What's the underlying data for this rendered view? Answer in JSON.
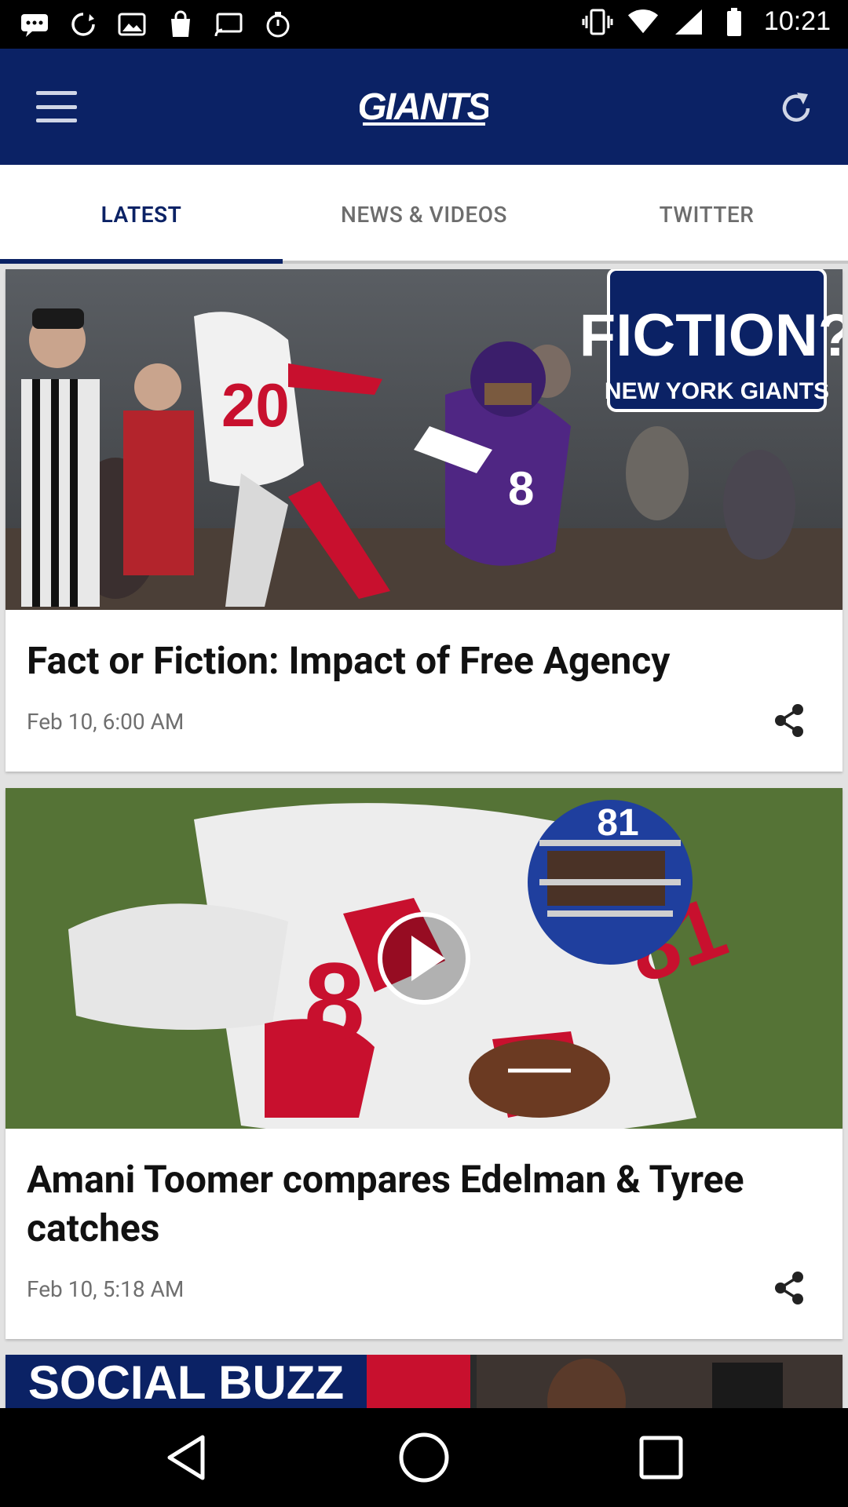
{
  "status_bar": {
    "time": "10:21"
  },
  "app_bar": {
    "logo_text": "GIANTS"
  },
  "tabs": [
    {
      "label": "LATEST"
    },
    {
      "label": "NEWS & VIDEOS"
    },
    {
      "label": "TWITTER"
    }
  ],
  "feed": [
    {
      "title": "Fact or Fiction: Impact of Free Agency",
      "date": "Feb 10, 6:00 AM",
      "image_overlay": {
        "line1": "FICTION?",
        "line2": "NEW YORK GIANTS"
      }
    },
    {
      "title": "Amani Toomer compares Edelman & Tyree catches",
      "date": "Feb 10, 5:18 AM",
      "has_video": true
    },
    {
      "image_overlay": {
        "line1": "SOCIAL BUZZ"
      }
    }
  ],
  "colors": {
    "brand_navy": "#0b2265",
    "brand_red": "#a71930"
  },
  "icons": {
    "menu": "hamburger-icon",
    "refresh": "refresh-icon",
    "share": "share-icon",
    "play": "play-icon"
  }
}
